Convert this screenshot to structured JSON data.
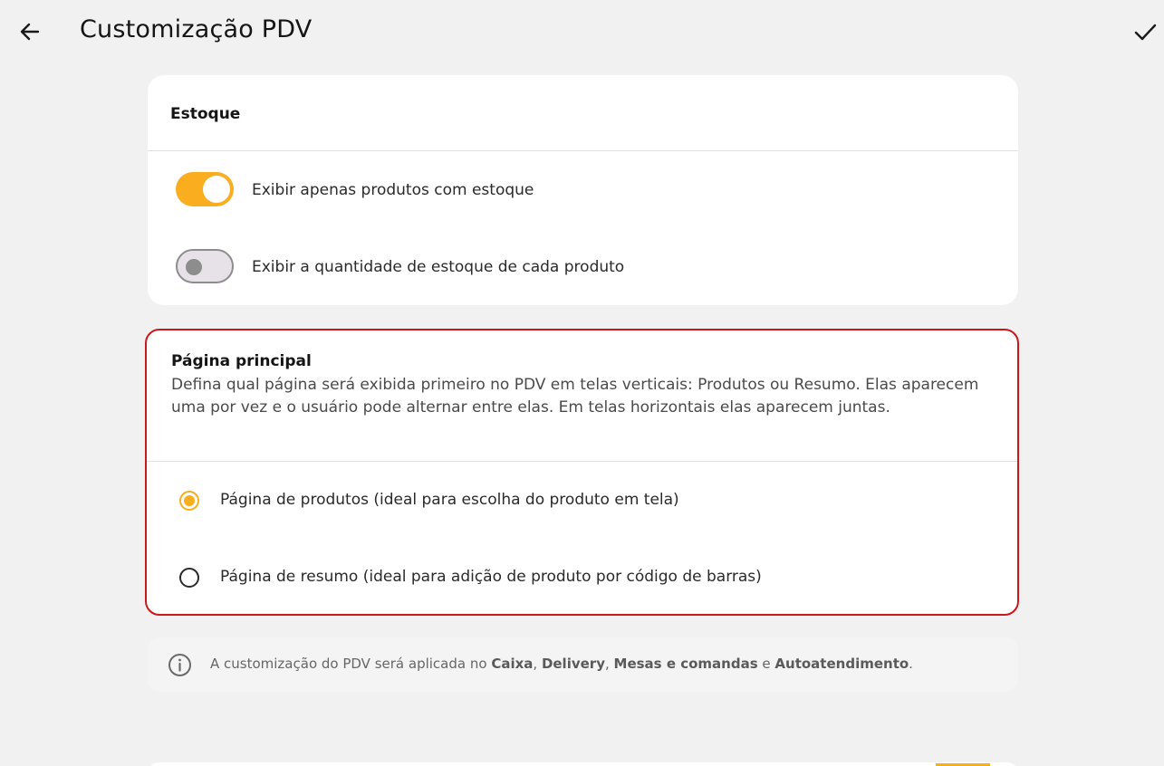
{
  "header": {
    "title": "Customização PDV",
    "back_icon": "arrow-left-icon",
    "confirm_icon": "check-icon"
  },
  "stock_section": {
    "title": "Estoque",
    "toggles": [
      {
        "label": "Exibir apenas produtos com estoque",
        "state": "on"
      },
      {
        "label": "Exibir a quantidade de estoque de cada produto",
        "state": "off"
      }
    ]
  },
  "main_page_section": {
    "title": "Página principal",
    "description": "Defina qual página será exibida primeiro no PDV em telas verticais: Produtos ou Resumo. Elas aparecem uma por vez e o usuário pode alternar entre elas. Em telas horizontais elas aparecem juntas.",
    "options": [
      {
        "label": "Página de produtos (ideal para escolha do produto em tela)",
        "selected": true
      },
      {
        "label": "Página de resumo (ideal para adição de produto por código de barras)",
        "selected": false
      }
    ]
  },
  "info": {
    "icon": "info-icon",
    "prefix": "A customização do PDV será aplicada no ",
    "channel_1": "Caixa",
    "sep_1": ", ",
    "channel_2": "Delivery",
    "sep_2": ", ",
    "channel_3": "Mesas e comandas",
    "sep_3": " e ",
    "channel_4": "Autoatendimento",
    "suffix": "."
  },
  "colors": {
    "accent": "#f9ad1f",
    "highlight_border": "#c8181b",
    "background": "#f1f1f1"
  }
}
